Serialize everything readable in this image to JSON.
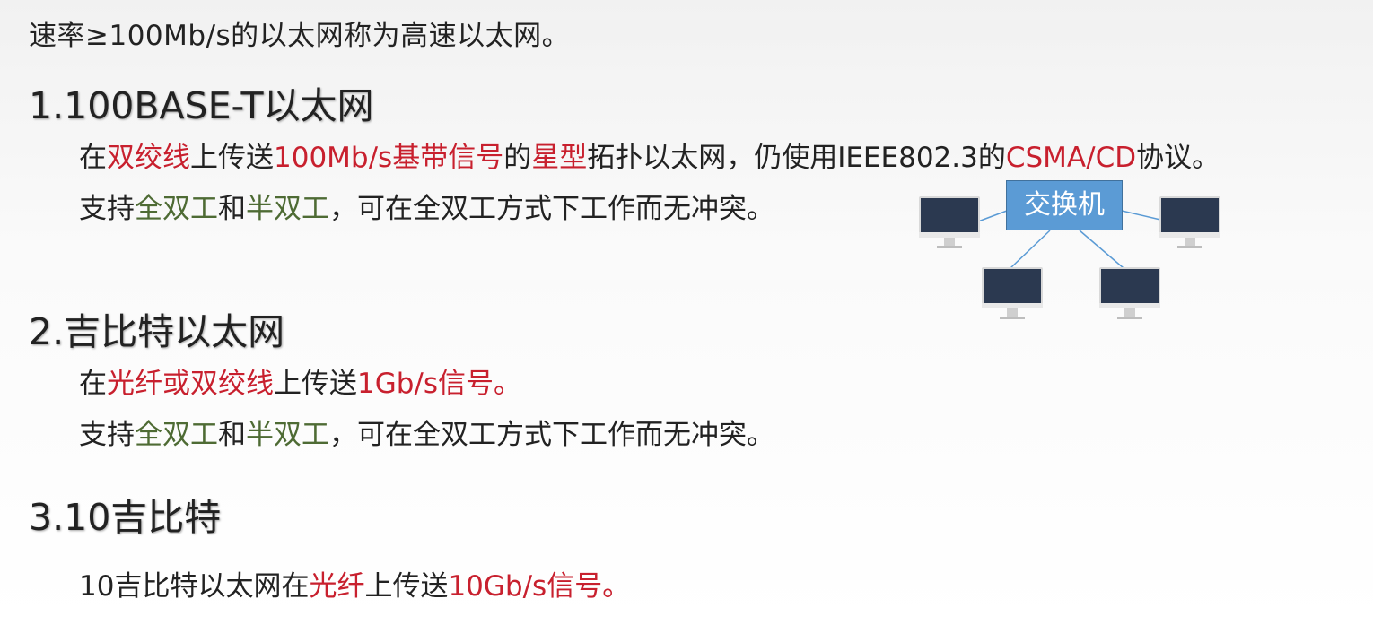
{
  "intro": {
    "text": "速率≥100Mb/s的以太网称为高速以太网。"
  },
  "section1": {
    "heading": "1.100BASE-T以太网",
    "line1": [
      "在",
      "双绞线",
      "上传送",
      "100Mb/s基带信号",
      "的",
      "星型",
      "拓扑以太网，仍使用IEEE802.3的",
      "CSMA/CD",
      "协议。"
    ],
    "line2": [
      "支持",
      "全双工",
      "和",
      "半双工",
      "，可在全双工方式下工作而无冲突。"
    ]
  },
  "diagram": {
    "switch_label": "交换机",
    "nodes": [
      "computer-icon",
      "computer-icon",
      "computer-icon",
      "computer-icon"
    ],
    "switch_color": "#5b9bd5",
    "link_color": "#5b9bd5"
  },
  "section2": {
    "heading": "2.吉比特以太网",
    "line1": [
      "在",
      "光纤或双绞线",
      "上传送",
      "1Gb/s信号",
      "。"
    ],
    "line2": [
      "支持",
      "全双工",
      "和",
      "半双工",
      "，可在全双工方式下工作而无冲突。"
    ]
  },
  "section3": {
    "heading": "3.10吉比特",
    "line1": [
      "10吉比特以太网在",
      "光纤",
      "上传送",
      "10Gb/s信号",
      "。"
    ]
  },
  "colors": {
    "emphasis_red": "#c8202e",
    "emphasis_green": "#4e6b34",
    "text": "#222222"
  }
}
